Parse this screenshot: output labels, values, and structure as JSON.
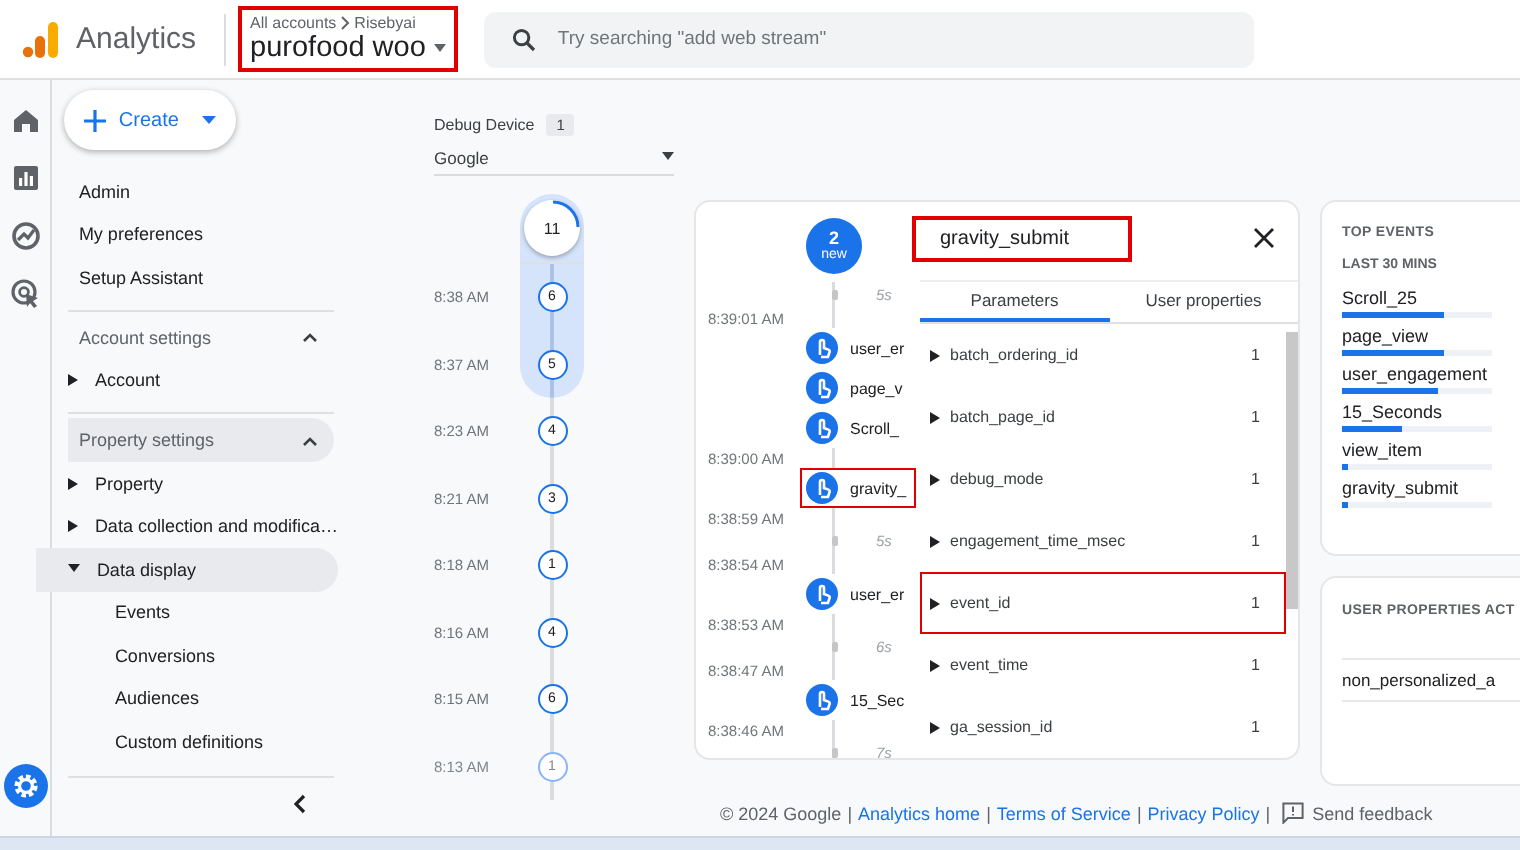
{
  "header": {
    "product": "Analytics",
    "breadcrumb": [
      "All accounts",
      "Risebyai"
    ],
    "account": "purofood woo",
    "account_annotated": true,
    "search": {
      "placeholder": "Try searching \"add web stream\""
    }
  },
  "rail": [
    {
      "kind": "home",
      "selected": false
    },
    {
      "kind": "reports",
      "selected": false
    },
    {
      "kind": "explore",
      "selected": false
    },
    {
      "kind": "advertising",
      "selected": false
    }
  ],
  "sidebar": {
    "create": "Create",
    "items": [
      {
        "label": "Admin"
      },
      {
        "label": "My preferences"
      },
      {
        "label": "Setup Assistant"
      }
    ],
    "sections": [
      {
        "label": "Account settings",
        "expanded": true,
        "hovered": false,
        "children": [
          {
            "label": "Account",
            "expanded": false,
            "selected": false
          }
        ]
      },
      {
        "label": "Property settings",
        "expanded": true,
        "hovered": true,
        "children": [
          {
            "label": "Property",
            "expanded": false,
            "selected": false
          },
          {
            "label": "Data collection and modifica…",
            "expanded": false,
            "selected": false
          },
          {
            "label": "Data display",
            "expanded": true,
            "selected": true,
            "children": [
              {
                "label": "Events",
                "selected": false
              },
              {
                "label": "Conversions",
                "selected": false
              },
              {
                "label": "Audiences",
                "selected": false
              },
              {
                "label": "Custom definitions",
                "selected": false
              }
            ]
          }
        ]
      }
    ]
  },
  "debug": {
    "label": "Debug Device",
    "count": "1",
    "device": "Google",
    "total": "11",
    "minutes": [
      {
        "time": "8:38 AM",
        "count": "6",
        "in_range": true,
        "faded": false
      },
      {
        "time": "8:37 AM",
        "count": "5",
        "in_range": true,
        "faded": false
      },
      {
        "time": "8:23 AM",
        "count": "4",
        "in_range": false,
        "faded": false
      },
      {
        "time": "8:21 AM",
        "count": "3",
        "in_range": false,
        "faded": false
      },
      {
        "time": "8:18 AM",
        "count": "1",
        "in_range": false,
        "faded": false
      },
      {
        "time": "8:16 AM",
        "count": "4",
        "in_range": false,
        "faded": false
      },
      {
        "time": "8:15 AM",
        "count": "6",
        "in_range": false,
        "faded": false
      },
      {
        "time": "8:13 AM",
        "count": "1",
        "in_range": false,
        "faded": true
      }
    ]
  },
  "stream": {
    "new_count": "2",
    "new_label": "new",
    "entries": [
      {
        "kind": "gap",
        "text": "5s"
      },
      {
        "kind": "time",
        "text": "8:39:01 AM"
      },
      {
        "kind": "event",
        "text": "user_er",
        "annotated": false
      },
      {
        "kind": "event",
        "text": "page_v",
        "annotated": false
      },
      {
        "kind": "event",
        "text": "Scroll_",
        "annotated": false
      },
      {
        "kind": "time",
        "text": "8:39:00 AM"
      },
      {
        "kind": "event",
        "text": "gravity_",
        "annotated": true
      },
      {
        "kind": "time",
        "text": "8:38:59 AM"
      },
      {
        "kind": "gap",
        "text": "5s"
      },
      {
        "kind": "time",
        "text": "8:38:54 AM"
      },
      {
        "kind": "event",
        "text": "user_er",
        "annotated": false
      },
      {
        "kind": "time",
        "text": "8:38:53 AM"
      },
      {
        "kind": "gap",
        "text": "6s"
      },
      {
        "kind": "time",
        "text": "8:38:47 AM"
      },
      {
        "kind": "event",
        "text": "15_Sec",
        "annotated": false
      },
      {
        "kind": "time",
        "text": "8:38:46 AM"
      },
      {
        "kind": "gap",
        "text": "7s"
      }
    ]
  },
  "detail": {
    "title": "gravity_submit",
    "annotated": true,
    "tabs": [
      {
        "label": "Parameters",
        "selected": true
      },
      {
        "label": "User properties",
        "selected": false
      }
    ],
    "params": [
      {
        "name": "batch_ordering_id",
        "count": "1",
        "annotated": false
      },
      {
        "name": "batch_page_id",
        "count": "1",
        "annotated": false
      },
      {
        "name": "debug_mode",
        "count": "1",
        "annotated": false
      },
      {
        "name": "engagement_time_msec",
        "count": "1",
        "annotated": false
      },
      {
        "name": "event_id",
        "count": "1",
        "annotated": true
      },
      {
        "name": "event_time",
        "count": "1",
        "annotated": false
      },
      {
        "name": "ga_session_id",
        "count": "1",
        "annotated": false
      }
    ]
  },
  "top_events": {
    "title": "TOP EVENTS",
    "subtitle": "LAST 30 MINS",
    "events": [
      {
        "name": "Scroll_25",
        "level": 0.68
      },
      {
        "name": "page_view",
        "level": 0.68
      },
      {
        "name": "user_engagement",
        "level": 0.64
      },
      {
        "name": "15_Seconds",
        "level": 0.4
      },
      {
        "name": "view_item",
        "level": 0.04
      },
      {
        "name": "gravity_submit",
        "level": 0.04
      }
    ]
  },
  "user_properties": {
    "title": "USER PROPERTIES ACT",
    "items": [
      "non_personalized_a"
    ]
  },
  "footer": {
    "parts": [
      {
        "kind": "text",
        "text": "© 2024 Google"
      },
      {
        "kind": "sep",
        "text": "|"
      },
      {
        "kind": "link",
        "text": "Analytics home"
      },
      {
        "kind": "sep",
        "text": "|"
      },
      {
        "kind": "link",
        "text": "Terms of Service"
      },
      {
        "kind": "sep",
        "text": "|"
      },
      {
        "kind": "link",
        "text": "Privacy Policy"
      },
      {
        "kind": "sep",
        "text": "|"
      }
    ],
    "feedback": "Send feedback"
  }
}
